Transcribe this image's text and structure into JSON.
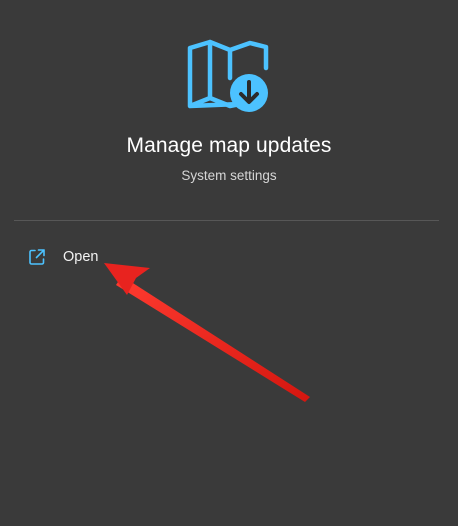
{
  "app": {
    "title": "Manage map updates",
    "subtitle": "System settings",
    "icon": "map-download-icon"
  },
  "actions": [
    {
      "label": "Open",
      "icon": "open-external-icon"
    }
  ],
  "annotation": {
    "type": "arrow",
    "color": "#e8231f",
    "target": "Open"
  },
  "colors": {
    "background": "#3a3a3a",
    "accent": "#4cc2ff",
    "divider": "#575757"
  }
}
